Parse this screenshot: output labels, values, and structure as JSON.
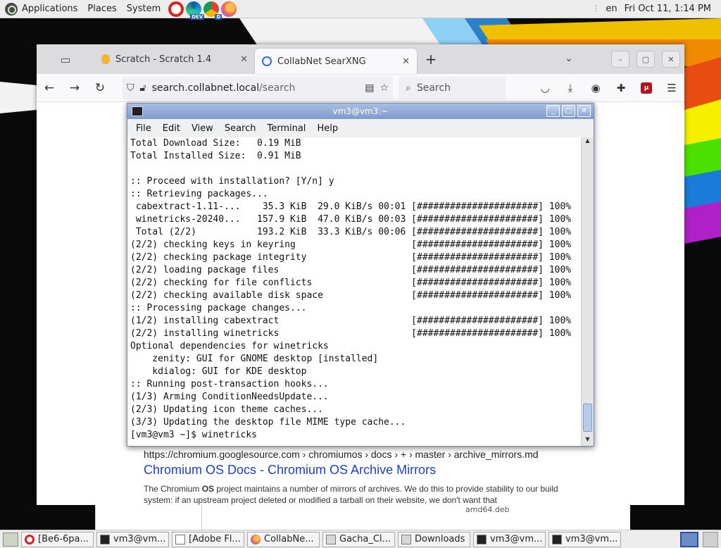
{
  "top_panel": {
    "menus": [
      "Applications",
      "Places",
      "System"
    ],
    "launchers": [
      {
        "name": "opera-icon"
      },
      {
        "name": "edge-dev-icon",
        "badge": "DEV"
      },
      {
        "name": "chrome-icon",
        "badge": "D"
      },
      {
        "name": "firefox-icon"
      }
    ],
    "keyboard_layout": "en",
    "clock": "Fri Oct 11, 1:14 PM"
  },
  "browser": {
    "tabs": [
      {
        "title": "Scratch - Scratch 1.4",
        "active": false
      },
      {
        "title": "CollabNet SearXNG",
        "active": true
      }
    ],
    "url": {
      "host": "search.collabnet.local",
      "path": "/search"
    },
    "search_placeholder": "Search",
    "result": {
      "url_line": "https://chromium.googlesource.com  › chromiumos › docs › + › master › archive_mirrors.md",
      "title": "Chromium OS Docs - Chromium OS Archive Mirrors",
      "snippet_before": "The Chromium ",
      "snippet_bold": "OS",
      "snippet_after": " project maintains a number of mirrors of archives. We do this to provide stability to our build system: if an upstream project deleted or modified a tarball on their website, we don't want that"
    }
  },
  "terminal": {
    "title": "vm3@vm3:~",
    "menu": [
      "File",
      "Edit",
      "View",
      "Search",
      "Terminal",
      "Help"
    ],
    "lines": [
      "Total Download Size:   0.19 MiB",
      "Total Installed Size:  0.91 MiB",
      "",
      ":: Proceed with installation? [Y/n] y",
      ":: Retrieving packages...",
      " cabextract-1.11-...    35.3 KiB  29.0 KiB/s 00:01 [######################] 100%",
      " winetricks-20240...   157.9 KiB  47.0 KiB/s 00:03 [######################] 100%",
      " Total (2/2)           193.2 KiB  33.3 KiB/s 00:06 [######################] 100%",
      "(2/2) checking keys in keyring                     [######################] 100%",
      "(2/2) checking package integrity                   [######################] 100%",
      "(2/2) loading package files                        [######################] 100%",
      "(2/2) checking for file conflicts                  [######################] 100%",
      "(2/2) checking available disk space                [######################] 100%",
      ":: Processing package changes...",
      "(1/2) installing cabextract                        [######################] 100%",
      "(2/2) installing winetricks                        [######################] 100%",
      "Optional dependencies for winetricks",
      "    zenity: GUI for GNOME desktop [installed]",
      "    kdialog: GUI for KDE desktop",
      ":: Running post-transaction hooks...",
      "(1/3) Arming ConditionNeedsUpdate...",
      "(2/3) Updating icon theme caches...",
      "(3/3) Updating the desktop file MIME type cache...",
      "[vm3@vm3 ~]$ winetricks"
    ]
  },
  "file_manager": {
    "visible_filename": "amd64.deb"
  },
  "taskbar": {
    "tasks": [
      {
        "label": "[Be6-6pa...",
        "icon": "opera"
      },
      {
        "label": "vm3@vm...",
        "icon": "term"
      },
      {
        "label": "[Adobe Fl...",
        "icon": "doc"
      },
      {
        "label": "CollabNe...",
        "icon": "firefox"
      },
      {
        "label": "Gacha_Cl...",
        "icon": "folder"
      },
      {
        "label": "Downloads",
        "icon": "folder"
      },
      {
        "label": "vm3@vm...",
        "icon": "term"
      },
      {
        "label": "vm3@vm...",
        "icon": "term"
      }
    ]
  },
  "colors": {
    "link": "#1a3fd0",
    "titlebar_gradient_top": "#a9bde0",
    "titlebar_gradient_bottom": "#7e9bcf"
  }
}
